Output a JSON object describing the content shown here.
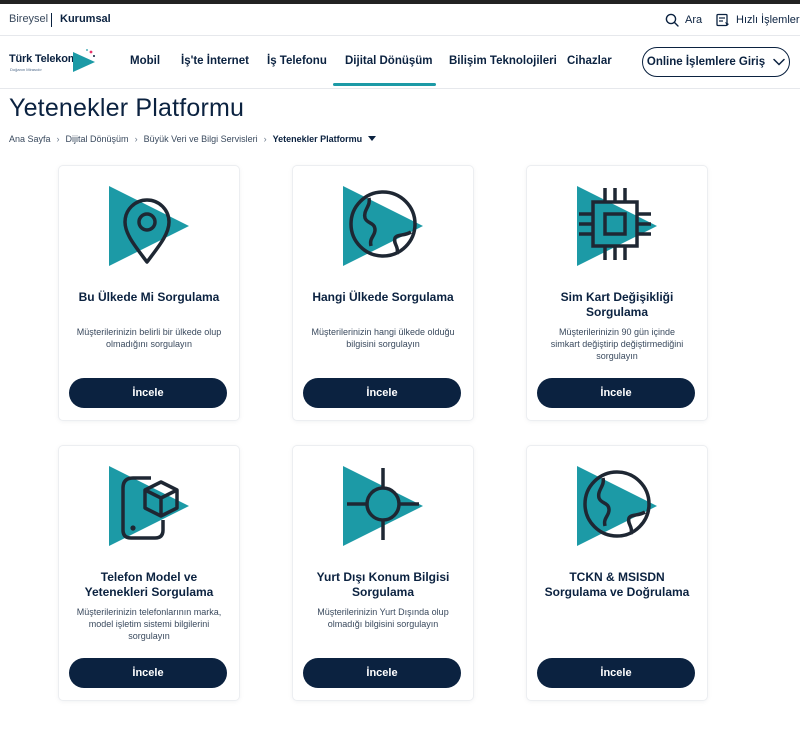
{
  "utility": {
    "segments": [
      "Bireysel",
      "Kurumsal"
    ],
    "search_label": "Ara",
    "quick_label": "Hızlı İşlemler"
  },
  "logo": {
    "name": "Türk Telekom",
    "tagline": "Doğanın Mirasıdır"
  },
  "nav": {
    "items": [
      "Mobil",
      "İş'te İnternet",
      "İş Telefonu",
      "Dijital Dönüşüm",
      "Bilişim Teknolojileri",
      "Cihazlar"
    ],
    "active": "Dijital Dönüşüm",
    "online_button": "Online İşlemlere Giriş"
  },
  "page": {
    "title": "Yetenekler Platformu"
  },
  "breadcrumb": [
    "Ana Sayfa",
    "Dijital Dönüşüm",
    "Büyük Veri ve Bilgi Servisleri",
    "Yetenekler Platformu"
  ],
  "colors": {
    "navy": "#0b2240",
    "teal": "#1c9aa6"
  },
  "cards": [
    {
      "icon": "location-pin-icon",
      "title_lines": [
        "Bu Ülkede Mi Sorgulama"
      ],
      "desc_lines": [
        "Müşterilerinizin belirli bir ülkede olup",
        "olmadığını sorgulayın"
      ],
      "button": "İncele"
    },
    {
      "icon": "globe-icon",
      "title_lines": [
        "Hangi Ülkede Sorgulama"
      ],
      "desc_lines": [
        "Müşterilerinizin hangi ülkede olduğu",
        "bilgisini sorgulayın"
      ],
      "button": "İncele"
    },
    {
      "icon": "sim-chip-icon",
      "title_lines": [
        "Sim Kart Değişikliği",
        "Sorgulama"
      ],
      "desc_lines": [
        "Müşterilerinizin 90 gün içinde",
        "simkart değiştirip değiştirmediğini",
        "sorgulayın"
      ],
      "button": "İncele"
    },
    {
      "icon": "phone-model-icon",
      "title_lines": [
        "Telefon Model ve",
        "Yetenekleri Sorgulama"
      ],
      "desc_lines": [
        "Müşterilerinizin telefonlarının marka,",
        "model işletim sistemi bilgilerini",
        "sorgulayın"
      ],
      "button": "İncele"
    },
    {
      "icon": "crosshair-icon",
      "title_lines": [
        "Yurt Dışı Konum Bilgisi",
        "Sorgulama"
      ],
      "desc_lines": [
        "Müşterilerinizin Yurt Dışında olup",
        "olmadığı bilgisini sorgulayın"
      ],
      "button": "İncele"
    },
    {
      "icon": "globe-icon",
      "title_lines": [
        "TCKN & MSISDN",
        "Sorgulama ve Doğrulama"
      ],
      "desc_lines": [],
      "button": "İncele"
    }
  ]
}
